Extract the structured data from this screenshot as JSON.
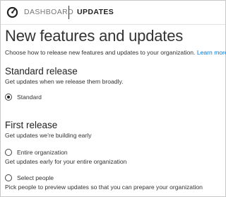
{
  "header": {
    "dashboard_label": "DASHBOARD",
    "active_label": "UPDATES",
    "icon": "speedometer-icon"
  },
  "page": {
    "title": "New features and updates",
    "intro": "Choose how to release new features and updates to your organization.",
    "learn_more": "Learn more"
  },
  "standard_release": {
    "title": "Standard release",
    "description": "Get updates when we release them broadly.",
    "option_label": "Standard",
    "selected": true
  },
  "first_release": {
    "title": "First release",
    "description": "Get updates we're building early",
    "options": [
      {
        "label": "Entire organization",
        "description": "Get updates early for your entire organization",
        "selected": false
      },
      {
        "label": "Select people",
        "description": "Pick people to preview updates so that you can prepare your organization",
        "selected": false
      }
    ]
  },
  "colors": {
    "link": "#0078d7",
    "text": "#333333",
    "border": "#c8c8c8"
  }
}
